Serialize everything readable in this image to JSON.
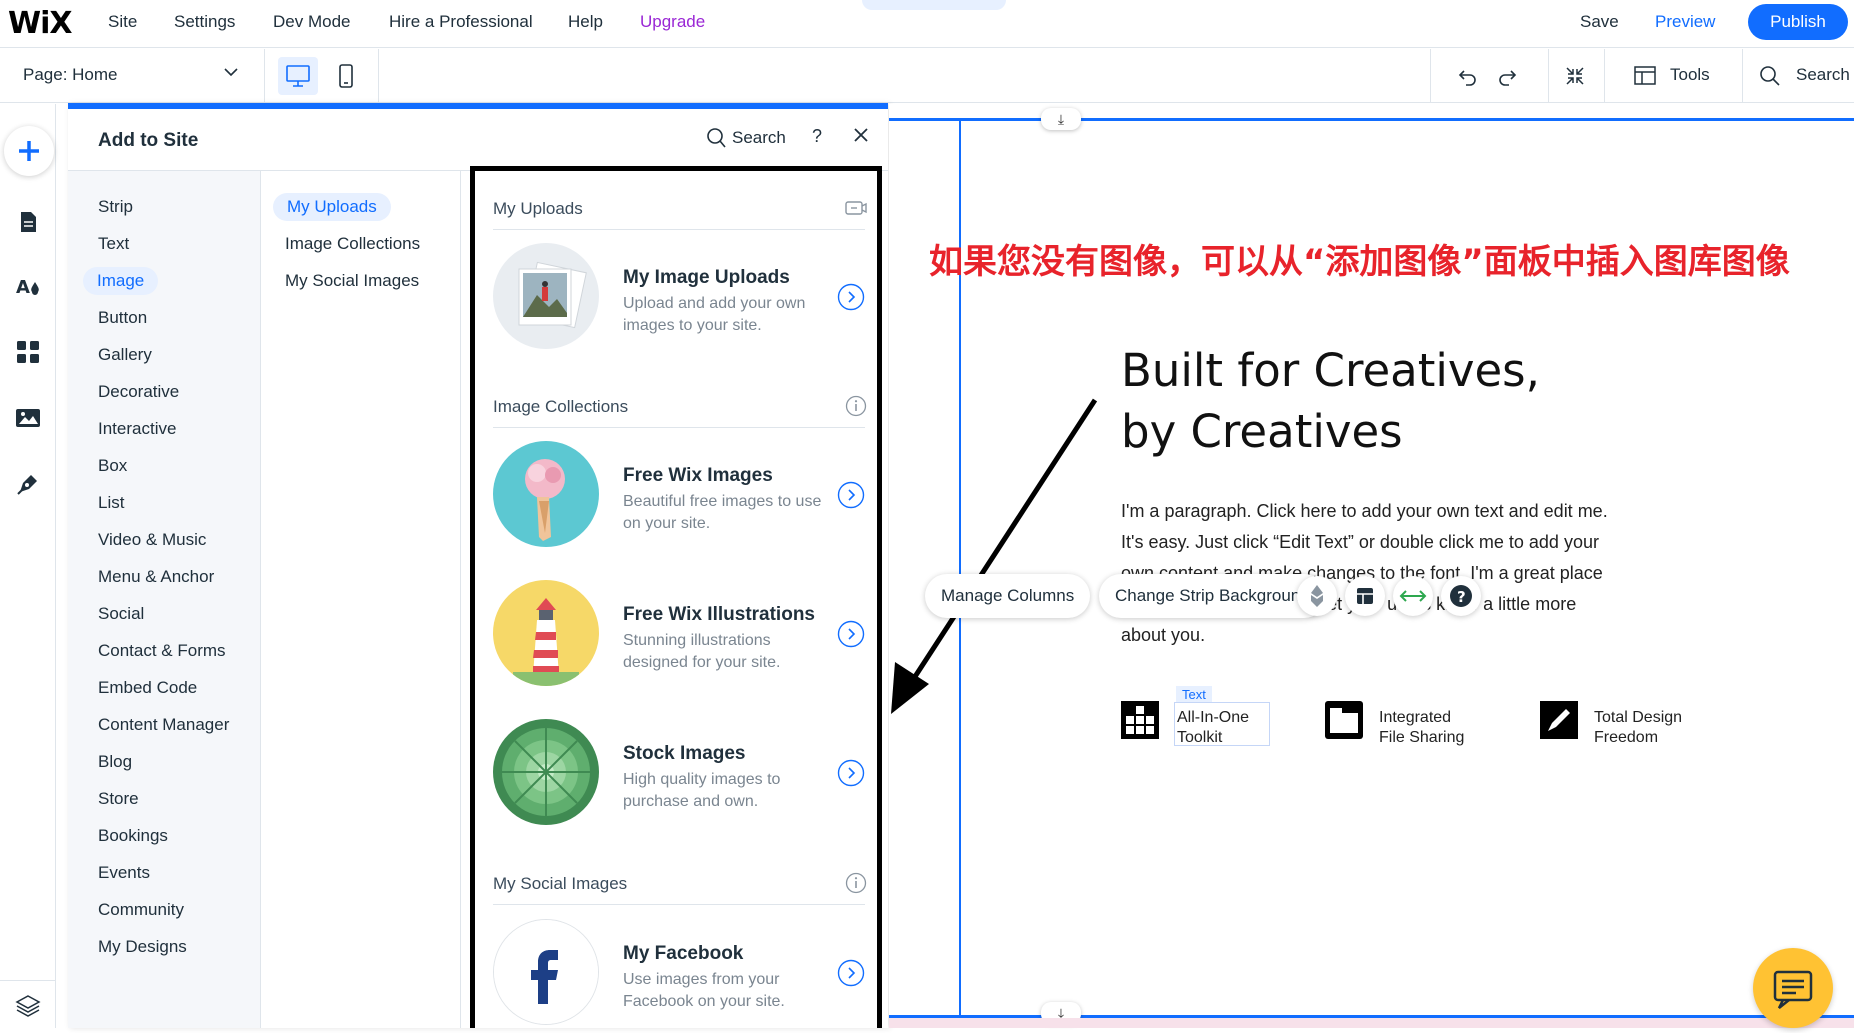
{
  "topbar": {
    "logo": "WiX",
    "menu": [
      "Site",
      "Settings",
      "Dev Mode",
      "Hire a Professional",
      "Help",
      "Upgrade"
    ],
    "save": "Save",
    "preview": "Preview",
    "publish": "Publish"
  },
  "subbar": {
    "page_label": "Page: Home",
    "tools": "Tools",
    "search": "Search"
  },
  "panel": {
    "title": "Add to Site",
    "search": "Search",
    "help": "?",
    "categories": [
      "Strip",
      "Text",
      "Image",
      "Button",
      "Gallery",
      "Decorative",
      "Interactive",
      "Box",
      "List",
      "Video & Music",
      "Menu & Anchor",
      "Social",
      "Contact & Forms",
      "Embed Code",
      "Content Manager",
      "Blog",
      "Store",
      "Bookings",
      "Events",
      "Community",
      "My Designs"
    ],
    "active_category": "Image",
    "subcategories": [
      "My Uploads",
      "Image Collections",
      "My Social Images"
    ],
    "active_subcategory": "My Uploads",
    "sections": [
      {
        "title": "My Uploads"
      },
      {
        "title": "Image Collections"
      },
      {
        "title": "My Social Images"
      }
    ],
    "items": [
      {
        "title": "My Image Uploads",
        "desc": "Upload and add your own images to your site."
      },
      {
        "title": "Free Wix Images",
        "desc": "Beautiful free images to use on your site."
      },
      {
        "title": "Free Wix Illustrations",
        "desc": "Stunning illustrations designed for your site."
      },
      {
        "title": "Stock Images",
        "desc": "High quality images to purchase and own."
      },
      {
        "title": "My Facebook",
        "desc": "Use images from your Facebook on your site."
      }
    ]
  },
  "canvas": {
    "annotation": "如果您没有图像，可以从“添加图像”面板中插入图库图像",
    "headline_line1": "Built for Creatives,",
    "headline_line2": "by Creatives",
    "paragraph": "I'm a paragraph. Click here to add your own text and edit me. It's easy. Just click “Edit Text” or double click me to add your own content and make changes to the font. I'm a great place for you to tell a story and let your users know a little more about you.",
    "manage_columns": "Manage Columns",
    "change_strip_bg": "Change Strip Background",
    "text_tag": "Text",
    "features": [
      {
        "line1": "All-In-One",
        "line2": "Toolkit"
      },
      {
        "line1": "Integrated",
        "line2": "File Sharing"
      },
      {
        "line1": "Total Design",
        "line2": "Freedom"
      }
    ]
  },
  "colors": {
    "accent": "#116dff",
    "upgrade": "#9a27d5",
    "annotation": "#e8232b",
    "chat": "#ffc233"
  }
}
